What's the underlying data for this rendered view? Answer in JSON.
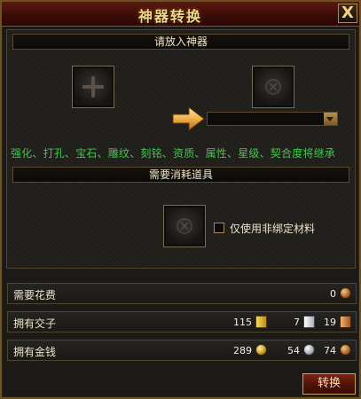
{
  "window": {
    "title": "神器转换",
    "close_label": "X"
  },
  "source": {
    "header": "请放入神器"
  },
  "target": {
    "selected": ""
  },
  "inherit_note": "强化、打孔、宝石、雕纹、刻铭、资质、属性、星级、契合度将继承",
  "materials": {
    "header": "需要消耗道具",
    "bound_only_label": "仅使用非绑定材料",
    "bound_only_checked": false
  },
  "cost": {
    "label": "需要花费",
    "copper": "0"
  },
  "notes": {
    "label": "拥有交子",
    "gold": "115",
    "silver": "7",
    "copper": "19"
  },
  "money": {
    "label": "拥有金钱",
    "gold": "289",
    "silver": "54",
    "copper": "74"
  },
  "actions": {
    "convert_label": "转换"
  },
  "colors": {
    "inherit_text": "#3ec84a",
    "title": "#f4d98a",
    "accent_border": "#c8a060"
  },
  "icons": {
    "close": "close-icon",
    "add_slot": "plus-icon",
    "arrow": "arrow-right-icon",
    "dropdown": "chevron-down-icon",
    "copper_coin": "copper-coin-icon",
    "gold_coin": "gold-coin-icon",
    "silver_coin": "silver-coin-icon",
    "gold_note": "gold-note-icon",
    "silver_note": "silver-note-icon",
    "copper_note": "copper-note-icon"
  }
}
